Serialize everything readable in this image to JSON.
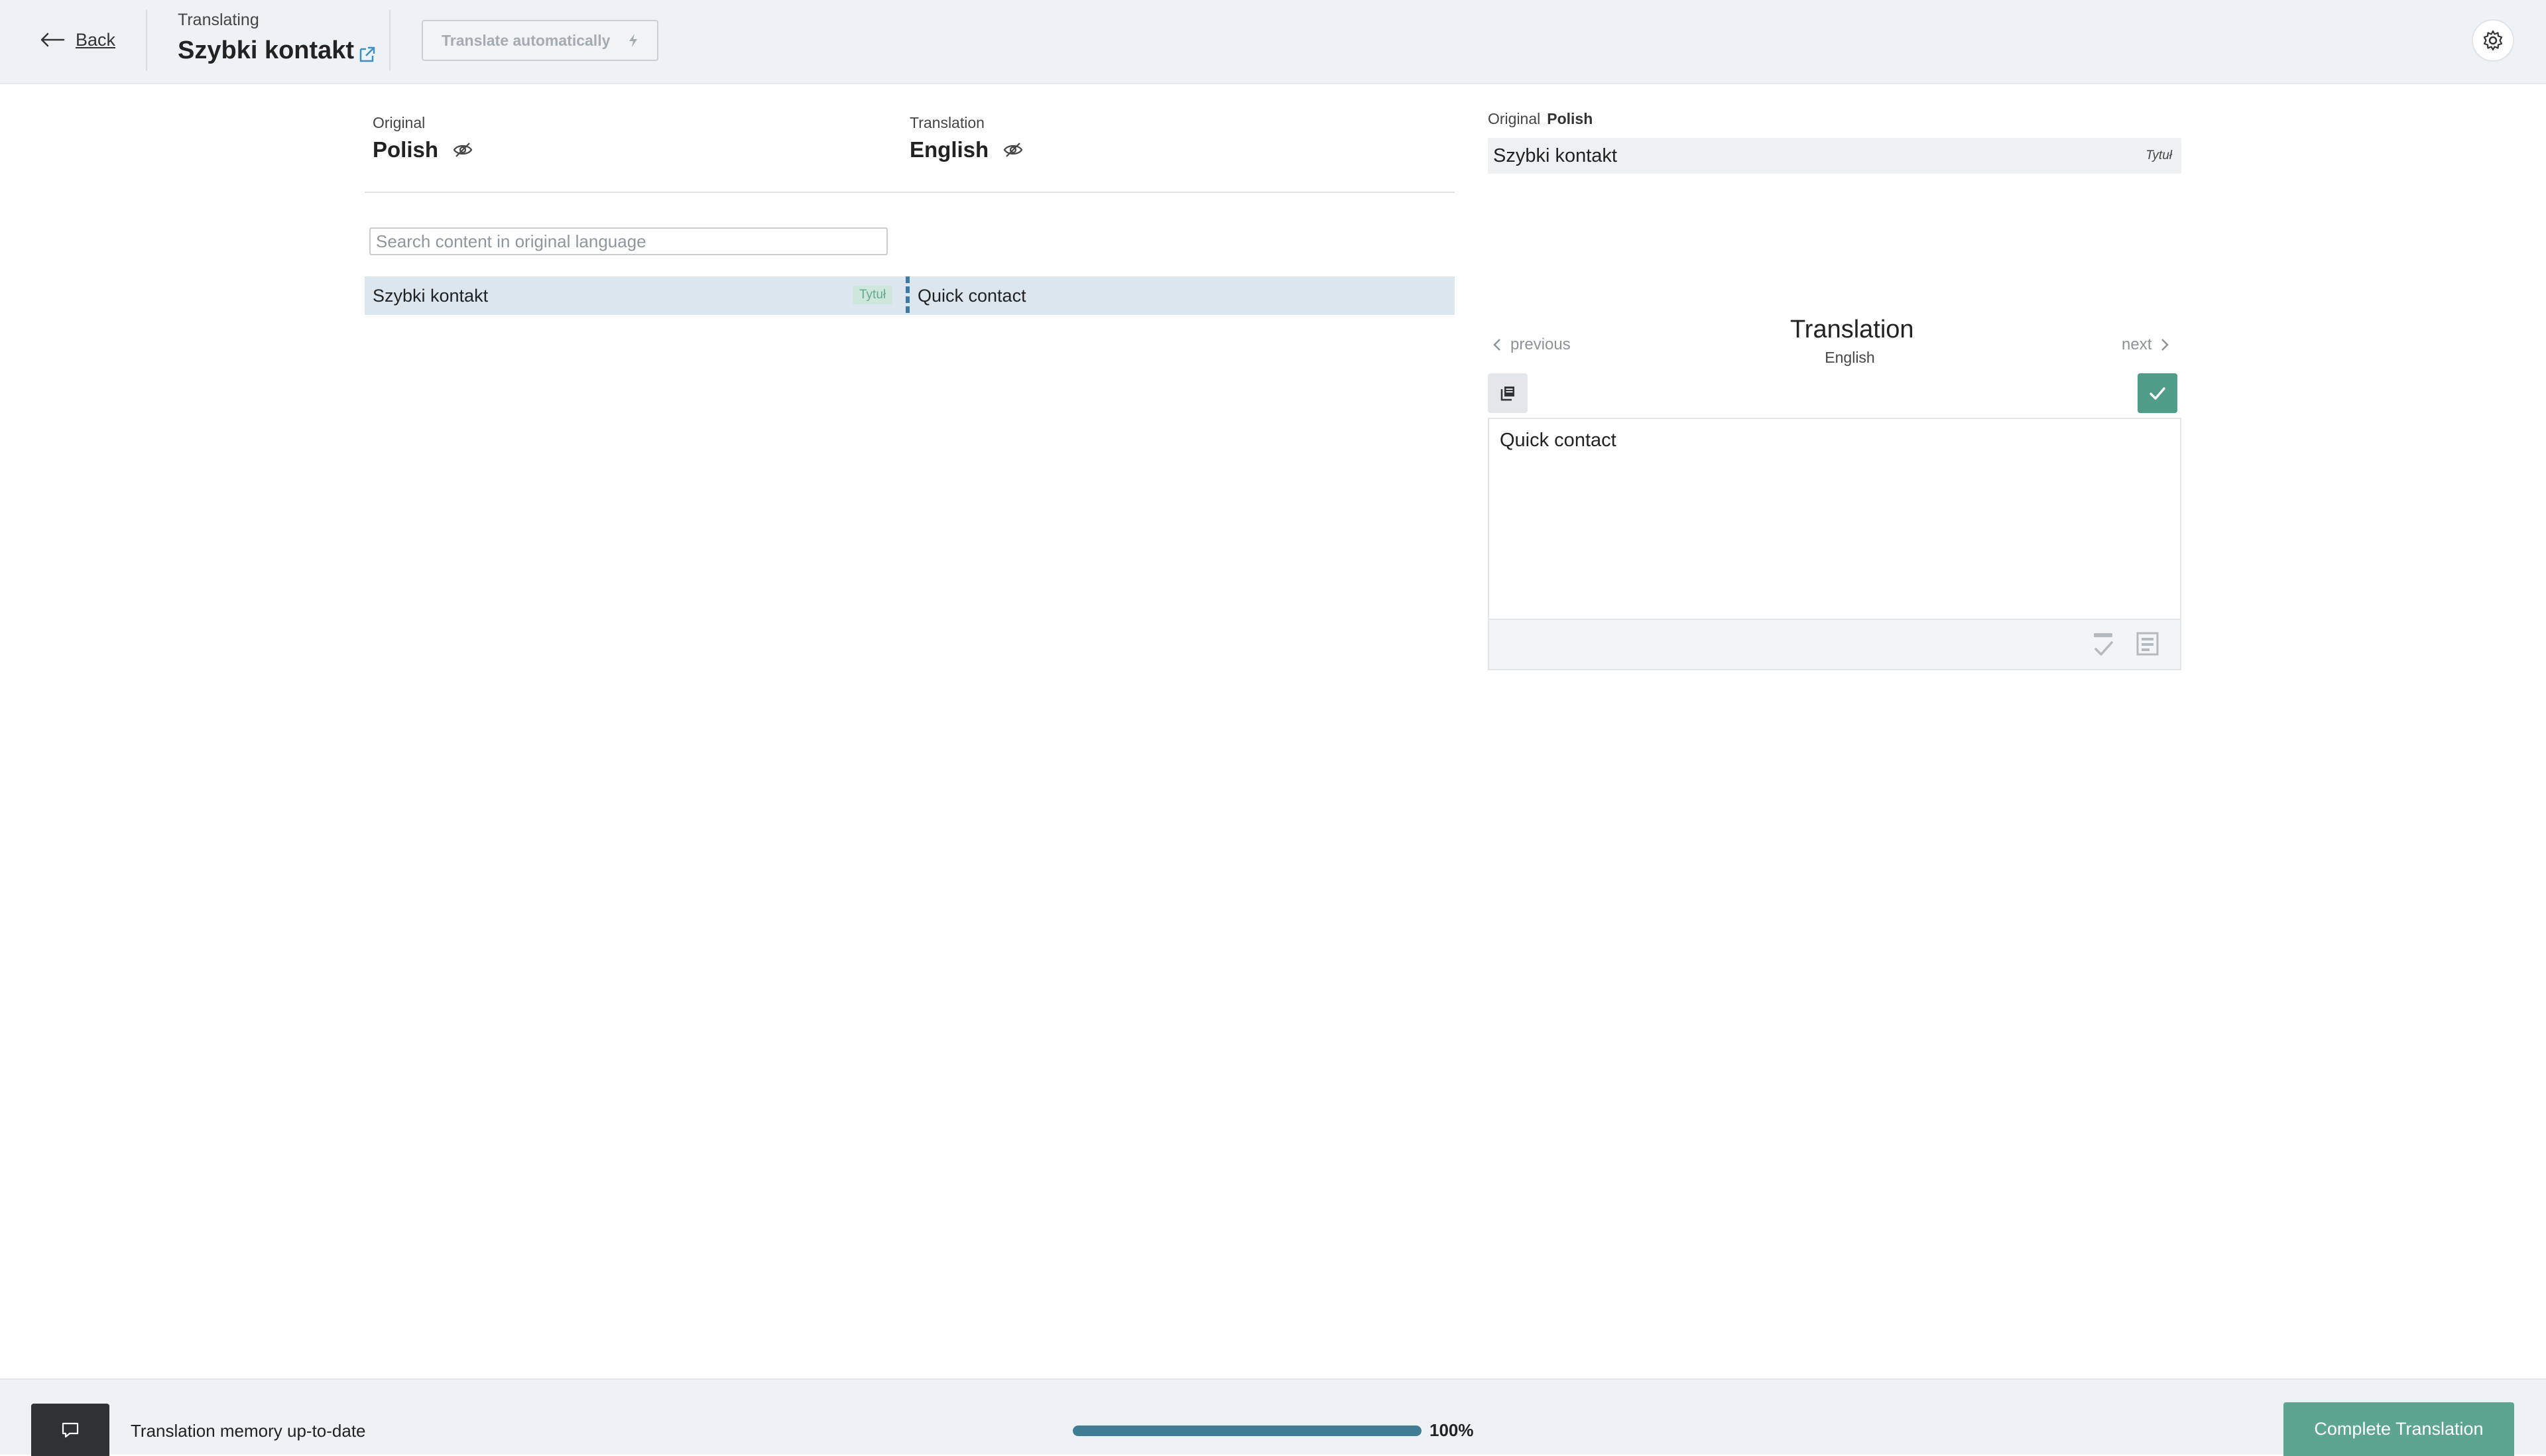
{
  "header": {
    "back_label": "Back",
    "kicker": "Translating",
    "title": "Szybki kontakt",
    "auto_translate_label": "Translate automatically"
  },
  "panel": {
    "original": {
      "label": "Original",
      "language": "Polish"
    },
    "translation": {
      "label": "Translation",
      "language": "English"
    },
    "search_placeholder": "Search content in original language",
    "rows": [
      {
        "original": "Szybki kontakt",
        "tag": "Tytuł",
        "translation": "Quick contact"
      }
    ]
  },
  "editor": {
    "original_label": "Original",
    "original_language": "Polish",
    "original_text": "Szybki kontakt",
    "original_tag": "Tytuł",
    "previous_label": "previous",
    "next_label": "next",
    "title": "Translation",
    "language": "English",
    "text": "Quick contact"
  },
  "footer": {
    "memory_status": "Translation memory up-to-date",
    "progress_label": "100%",
    "progress_fraction": 1.0,
    "complete_label": "Complete Translation"
  },
  "colors": {
    "accent_green": "#5da58f",
    "progress_blue": "#3f7d95",
    "row_highlight": "#dbe6ef"
  }
}
